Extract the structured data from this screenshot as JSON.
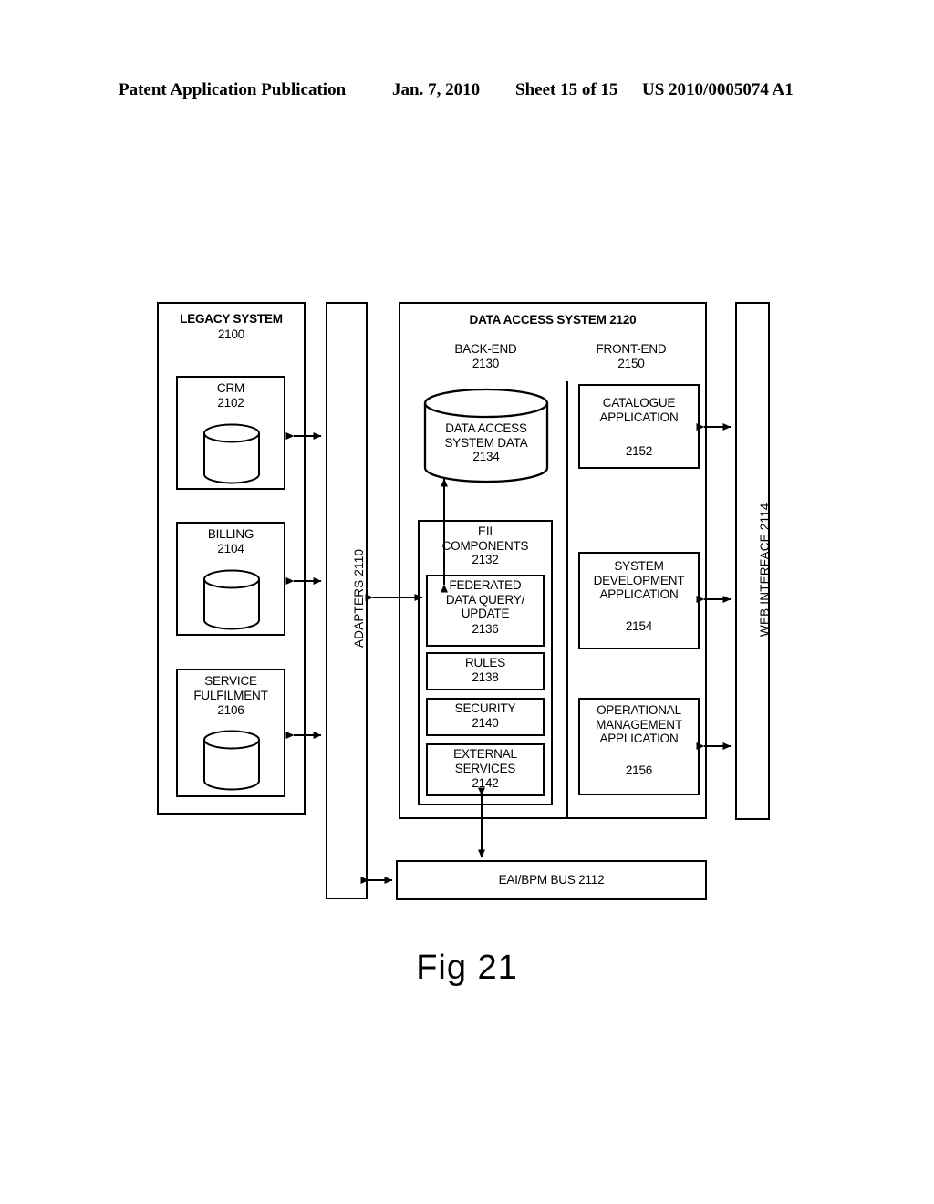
{
  "header": {
    "publication": "Patent Application Publication",
    "date": "Jan. 7, 2010",
    "sheet": "Sheet 15 of 15",
    "patent_number": "US 2010/0005074 A1"
  },
  "figure": {
    "caption": "Fig 21",
    "legacy_system": {
      "title": "LEGACY SYSTEM",
      "ref": "2100",
      "components": [
        {
          "label": "CRM",
          "ref": "2102",
          "icon": "database-cylinder-icon"
        },
        {
          "label": "BILLING",
          "ref": "2104",
          "icon": "database-cylinder-icon"
        },
        {
          "label": "SERVICE\nFULFILMENT",
          "ref": "2106",
          "icon": "database-cylinder-icon"
        }
      ]
    },
    "adapters": {
      "label": "ADAPTERS 2110"
    },
    "data_access_system": {
      "title": "DATA ACCESS SYSTEM  2120",
      "back_end": {
        "title": "BACK-END",
        "ref": "2130",
        "datastore": {
          "label": "DATA ACCESS\nSYSTEM DATA",
          "ref": "2134",
          "icon": "database-cylinder-icon"
        },
        "eii": {
          "title": "EII\nCOMPONENTS",
          "ref": "2132",
          "items": [
            {
              "label": "FEDERATED\nDATA QUERY/\nUPDATE",
              "ref": "2136"
            },
            {
              "label": "RULES",
              "ref": "2138"
            },
            {
              "label": "SECURITY",
              "ref": "2140"
            },
            {
              "label": "EXTERNAL\nSERVICES",
              "ref": "2142"
            }
          ]
        }
      },
      "front_end": {
        "title": "FRONT-END",
        "ref": "2150",
        "applications": [
          {
            "label": "CATALOGUE\nAPPLICATION",
            "ref": "2152"
          },
          {
            "label": "SYSTEM\nDEVELOPMENT\nAPPLICATION",
            "ref": "2154"
          },
          {
            "label": "OPERATIONAL\nMANAGEMENT\nAPPLICATION",
            "ref": "2156"
          }
        ]
      }
    },
    "web_interface": {
      "label": "WEB INTERFACE 2114"
    },
    "eai_bpm_bus": {
      "label": "EAI/BPM BUS  2112"
    }
  },
  "colors": {
    "ink": "#000000",
    "paper": "#ffffff"
  }
}
